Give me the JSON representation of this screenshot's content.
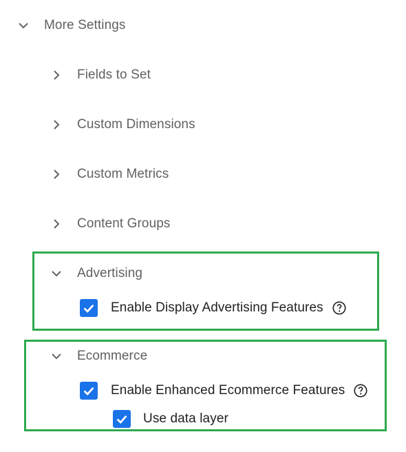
{
  "more_settings": {
    "label": "More Settings",
    "expanded": true,
    "icon": "chevron-down-icon"
  },
  "sections": {
    "fields_to_set": {
      "label": "Fields to Set",
      "expanded": false,
      "icon": "chevron-right-icon"
    },
    "custom_dimensions": {
      "label": "Custom Dimensions",
      "expanded": false,
      "icon": "chevron-right-icon"
    },
    "custom_metrics": {
      "label": "Custom Metrics",
      "expanded": false,
      "icon": "chevron-right-icon"
    },
    "content_groups": {
      "label": "Content Groups",
      "expanded": false,
      "icon": "chevron-right-icon"
    },
    "advertising": {
      "label": "Advertising",
      "expanded": true,
      "icon": "chevron-down-icon",
      "checkbox": {
        "label": "Enable Display Advertising Features",
        "checked": true,
        "help_icon": "help-icon"
      }
    },
    "ecommerce": {
      "label": "Ecommerce",
      "expanded": true,
      "icon": "chevron-down-icon",
      "checkbox": {
        "label": "Enable Enhanced Ecommerce Features",
        "checked": true,
        "help_icon": "help-icon"
      },
      "sub_checkbox": {
        "label": "Use data layer",
        "checked": true
      }
    }
  },
  "colors": {
    "checkbox_blue": "#1a73e8",
    "highlight_green": "#2eaa4f",
    "label_gray": "#616161"
  }
}
